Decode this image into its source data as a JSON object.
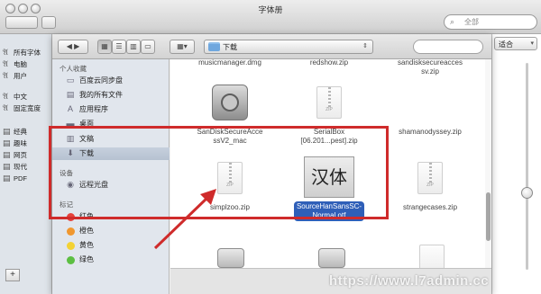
{
  "font_book": {
    "title": "字体册",
    "search_placeholder": "全部",
    "library_heading": "所有字体",
    "library_items": [
      "电脑",
      "用户"
    ],
    "collections": [
      {
        "icon": "font-icon",
        "label": "中文"
      },
      {
        "icon": "font-icon",
        "label": "固定宽度"
      }
    ],
    "categories": [
      "经典",
      "趣味",
      "网页",
      "现代",
      "PDF"
    ],
    "add_button": "+",
    "size_select": "适合"
  },
  "dialog": {
    "path": "下载",
    "sidebar": {
      "favorites_heading": "个人收藏",
      "favorites": [
        {
          "icon": "cloud-drive-icon",
          "label": "百度云同步盘"
        },
        {
          "icon": "all-files-icon",
          "label": "我的所有文件"
        },
        {
          "icon": "applications-icon",
          "label": "应用程序"
        },
        {
          "icon": "desktop-icon",
          "label": "桌面"
        },
        {
          "icon": "documents-icon",
          "label": "文稿"
        },
        {
          "icon": "downloads-icon",
          "label": "下载",
          "selected": true
        }
      ],
      "devices_heading": "设备",
      "devices": [
        {
          "icon": "optical-disc-icon",
          "label": "远程光盘"
        }
      ],
      "tags_heading": "标记",
      "tags": [
        {
          "label": "红色",
          "color": "#e5413a"
        },
        {
          "label": "橙色",
          "color": "#f0972f"
        },
        {
          "label": "黄色",
          "color": "#f3d234"
        },
        {
          "label": "绿色",
          "color": "#5cbf42"
        }
      ]
    },
    "files": [
      {
        "name": "musicmanager.dmg",
        "kind": "partial"
      },
      {
        "name": "redshow.zip",
        "kind": "partial"
      },
      {
        "name": "sandisksecureaccesv.zip",
        "kind": "partial",
        "lines": [
          "sandisksecureacces",
          "sv.zip"
        ]
      },
      {
        "name": "SanDiskSecureAccessV2_mac",
        "kind": "safe",
        "lines": [
          "SanDiskSecureAcce",
          "ssV2_mac"
        ]
      },
      {
        "name": "SerialBox [06.201...pest].zip",
        "kind": "zip",
        "lines": [
          "SerialBox",
          "[06.201...pest].zip"
        ]
      },
      {
        "name": "shamanodyssey.zip",
        "kind": "zip"
      },
      {
        "name": "simplzoo.zip",
        "kind": "zip"
      },
      {
        "name": "SourceHanSansSC-Normal.otf",
        "kind": "font",
        "glyph": "汉体",
        "selected": true,
        "lines": [
          "SourceHanSansSC-",
          "Normal.otf"
        ]
      },
      {
        "name": "strangecases.zip",
        "kind": "zip"
      }
    ],
    "zip_badge": "ZIP"
  },
  "watermark": "https://www.l7admin.cc",
  "colors": {
    "annotation_red": "#cf2b2b",
    "selection_blue": "#2f5fb8"
  }
}
